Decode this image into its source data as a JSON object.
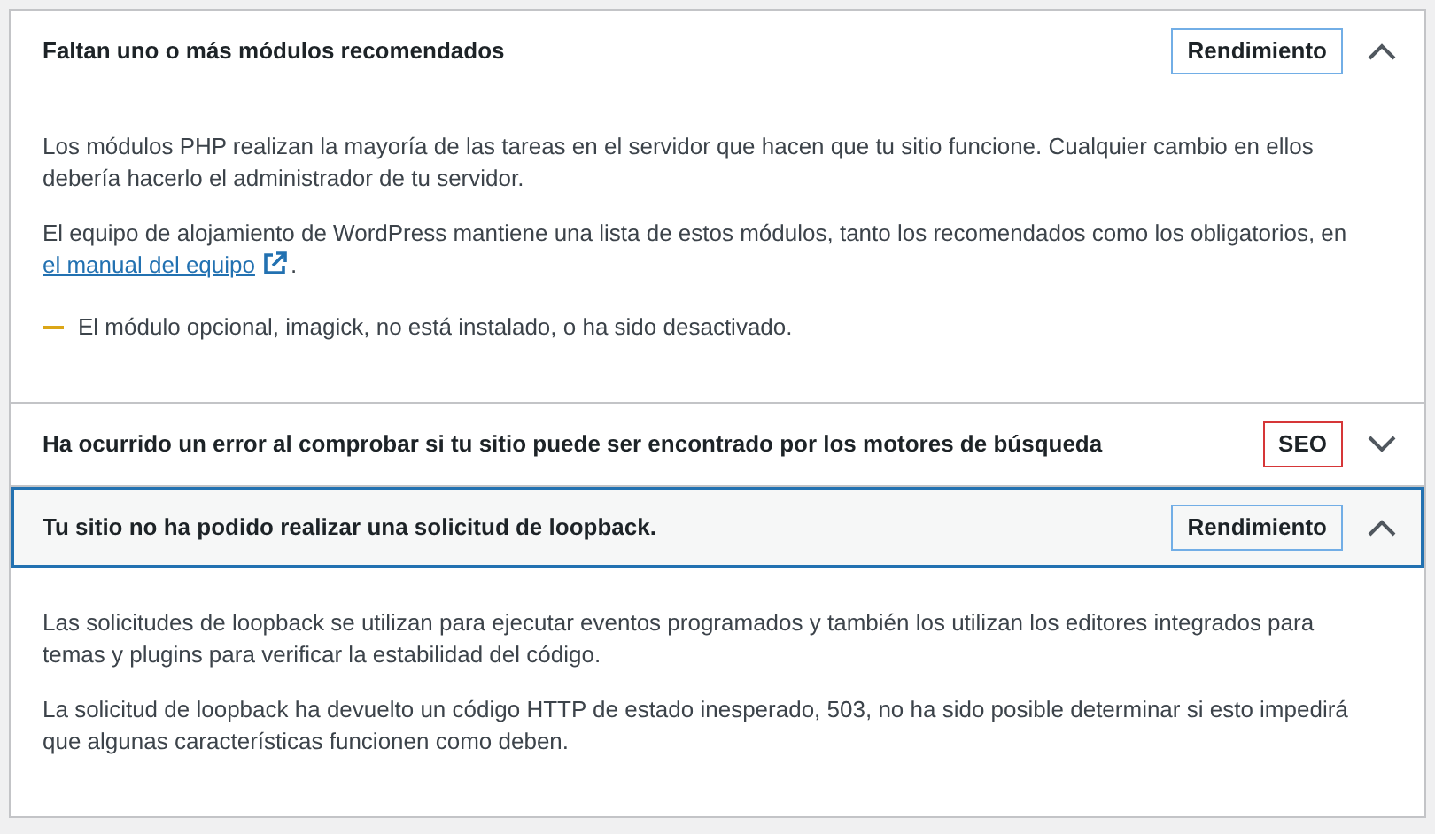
{
  "items": [
    {
      "title": "Faltan uno o más módulos recomendados",
      "badge": {
        "label": "Rendimiento",
        "color": "#72aee6"
      },
      "expanded": true,
      "focused": false,
      "body": [
        {
          "kind": "text",
          "text": "Los módulos PHP realizan la mayoría de las tareas en el servidor que hacen que tu sitio funcione. Cualquier cambio en ellos debería hacerlo el administrador de tu servidor."
        },
        {
          "kind": "link",
          "before": "El equipo de alojamiento de WordPress mantiene una lista de estos módulos, tanto los recomendados como los obligatorios, en ",
          "link": "el manual del equipo",
          "after": "."
        },
        {
          "kind": "notice",
          "text": "El módulo opcional, imagick, no está instalado, o ha sido desactivado.",
          "color": "#dba617"
        }
      ]
    },
    {
      "title": "Ha ocurrido un error al comprobar si tu sitio puede ser encontrado por los motores de búsqueda",
      "badge": {
        "label": "SEO",
        "color": "#d63638"
      },
      "expanded": false,
      "focused": false
    },
    {
      "title": "Tu sitio no ha podido realizar una solicitud de loopback.",
      "badge": {
        "label": "Rendimiento",
        "color": "#72aee6"
      },
      "expanded": true,
      "focused": true,
      "body": [
        {
          "kind": "text",
          "text": "Las solicitudes de loopback se utilizan para ejecutar eventos programados y también los utilizan los editores integrados para temas y plugins para verificar la estabilidad del código."
        },
        {
          "kind": "text",
          "text": "La solicitud de loopback ha devuelto un código HTTP de estado inesperado, 503, no ha sido posible determinar si esto impedirá que algunas características funcionen como deben."
        }
      ]
    }
  ]
}
